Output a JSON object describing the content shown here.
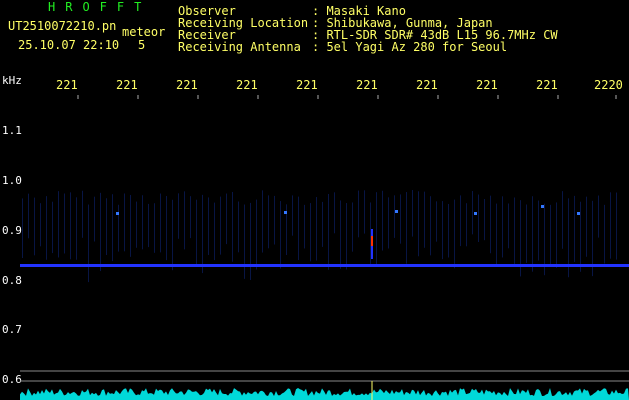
{
  "header": {
    "system": "HROFFT",
    "filename": "UT2510072210.pn",
    "mode": "meteor",
    "datetime": "25.10.07 22:10",
    "count": "5"
  },
  "observer_info": [
    {
      "label": "Observer",
      "value": ":  Masaki Kano"
    },
    {
      "label": "Receiving Location",
      "value": ":  Shibukawa, Gunma, Japan"
    },
    {
      "label": "Receiver",
      "value": ":  RTL-SDR SDR# 43dB L15 96.7MHz CW"
    },
    {
      "label": "Receiving Antenna",
      "value": ":  5el Yagi Az 280 for Seoul"
    }
  ],
  "time_axis": {
    "ticks": [
      "221",
      "221",
      "221",
      "221",
      "221",
      "221",
      "221",
      "221",
      "221",
      "2220"
    ]
  },
  "freq_axis": {
    "unit": "kHz",
    "ticks": [
      "1.1",
      "1.0",
      "0.9",
      "0.8",
      "0.7",
      "0.6"
    ]
  },
  "colors": {
    "text_yellow": "#ffff66",
    "text_green": "#22ee22",
    "noise_line": "#2233ff",
    "spectrum": "#00ffff",
    "meteor_head": "#ff3300"
  }
}
